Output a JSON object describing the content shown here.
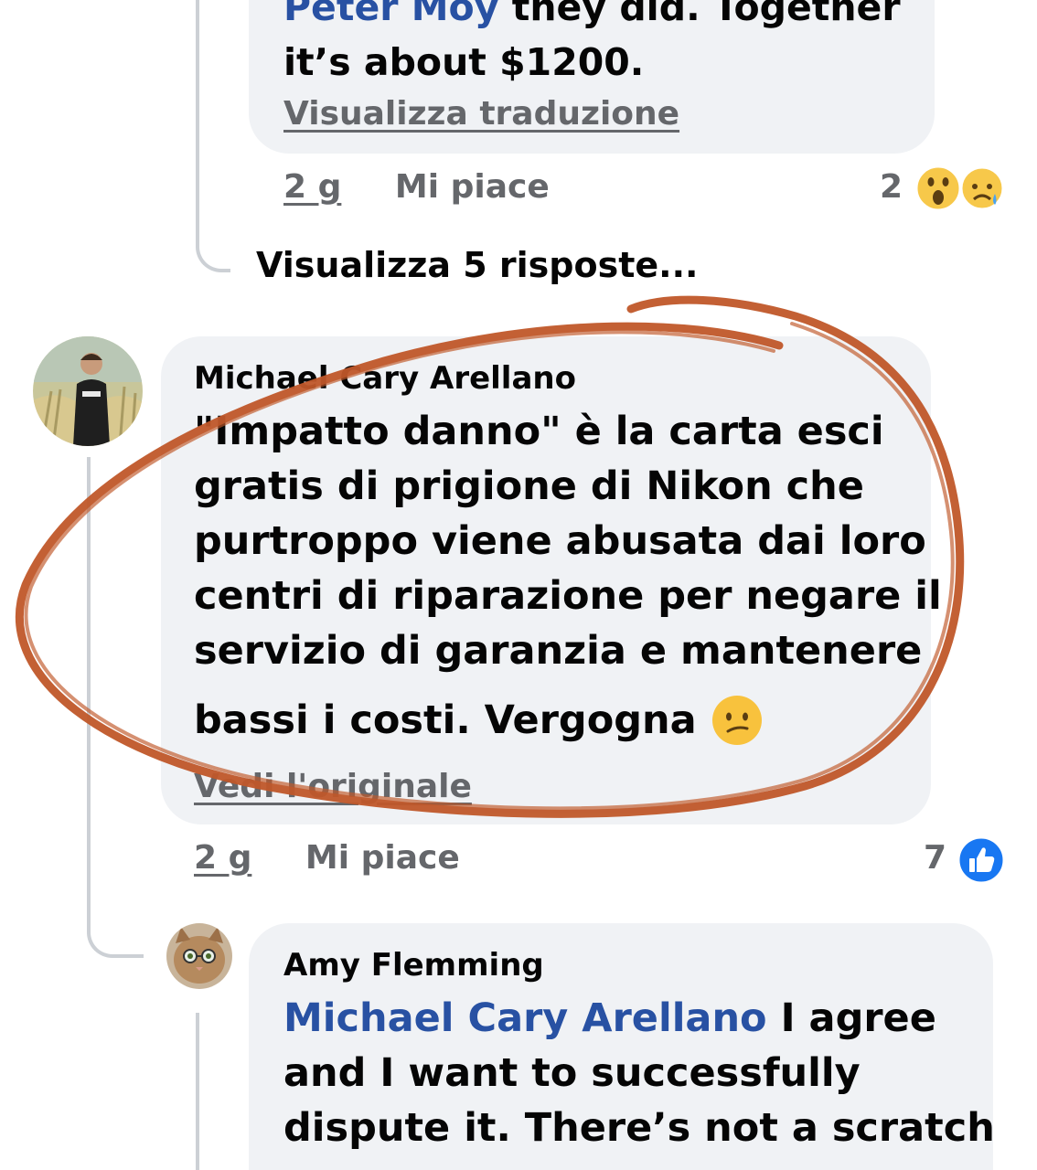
{
  "comment_prev": {
    "mention": "Peter Moy",
    "text_line1_rest": " they did. Together",
    "text_line2": "it’s about $1200.",
    "translate_link": "Visualizza traduzione",
    "time": "2 g",
    "like_label": "Mi piace",
    "reaction_count": "2",
    "reaction_icons": [
      "wow-icon",
      "sad-icon"
    ]
  },
  "view_replies": "Visualizza 5 risposte...",
  "comment_main": {
    "author": "Michael Cary Arellano",
    "lines": [
      "\"Impatto danno\" è la carta esci",
      "gratis di prigione di Nikon che",
      "purtroppo viene abusata dai loro",
      "centri di riparazione per negare il",
      "servizio di garanzia e mantenere"
    ],
    "last_line": "bassi i costi. Vergogna",
    "emoji": "confused-face-icon",
    "original_link": "Vedi l'originale",
    "time": "2 g",
    "like_label": "Mi piace",
    "reaction_count": "7",
    "reaction_icon": "like-icon"
  },
  "reply": {
    "author": "Amy Flemming",
    "mention": "Michael Cary Arellano",
    "line1_rest": " I agree",
    "line2": "and I want to successfully",
    "line3": "dispute it. There’s not a scratch"
  },
  "colors": {
    "bubble": "#f0f2f5",
    "mention": "#2851a3",
    "meta": "#65676b",
    "annotation": "#c0582a",
    "like_blue": "#1877f2"
  }
}
